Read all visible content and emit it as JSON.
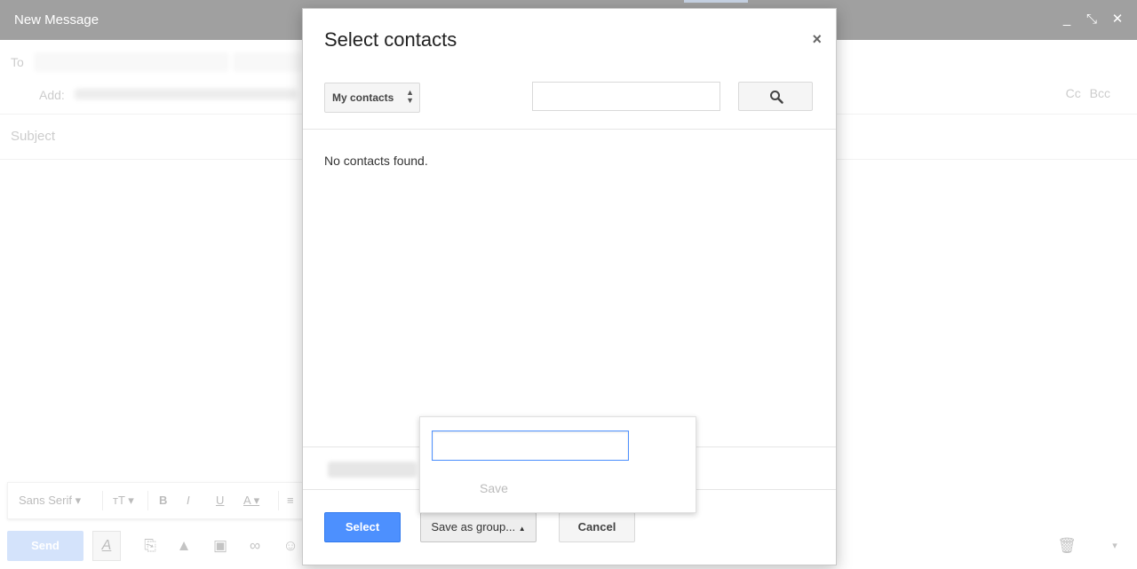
{
  "compose": {
    "title": "New Message",
    "to_label": "To",
    "add_label": "Add:",
    "cc_bcc": "Cc Bcc",
    "subject_placeholder": "Subject",
    "font_family": "Sans Serif",
    "send_label": "Send",
    "header_controls": [
      "minimize-icon",
      "pop-out-icon",
      "close-icon"
    ]
  },
  "modal": {
    "title": "Select contacts",
    "close_glyph": "×",
    "contacts_dropdown": "My contacts",
    "search_value": "",
    "empty_message": "No contacts found.",
    "buttons": {
      "select": "Select",
      "save_as_group": "Save as group...",
      "cancel": "Cancel"
    }
  },
  "group_popup": {
    "input_value": "",
    "save_label": "Save"
  },
  "colors": {
    "header_bg": "#404040",
    "primary_button": "#4d90fe",
    "send_disabled": "#a8c6f7"
  }
}
